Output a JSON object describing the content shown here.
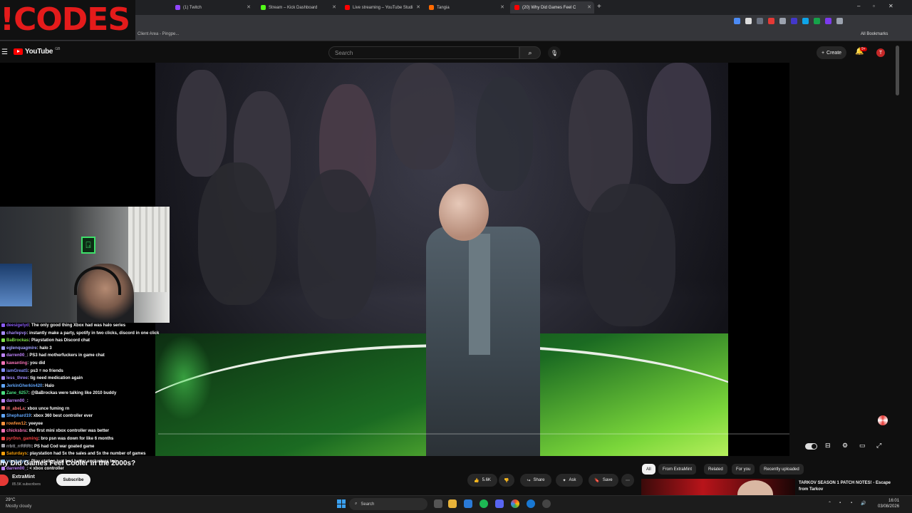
{
  "browser": {
    "tabs": [
      {
        "label": "(1) Twitch",
        "color": "#9146ff"
      },
      {
        "label": "Stream – Kick Dashboard",
        "color": "#53fc18"
      },
      {
        "label": "Live streaming – YouTube Studi",
        "color": "#ff0000"
      },
      {
        "label": "Tangia",
        "color": "#ff6a00"
      },
      {
        "label": "(20) Why Did Games Feel C",
        "color": "#ff0000"
      }
    ],
    "bookmarks": {
      "client": "Client Area - Pingpe...",
      "all": "All Bookmarks"
    }
  },
  "overlay": {
    "logo_text": "!CODES"
  },
  "youtube": {
    "logo": "YouTube",
    "country": "GB",
    "search_placeholder": "Search",
    "create_label": "Create",
    "notifications": "9+",
    "avatar_letter": "T"
  },
  "video": {
    "title": "hy Did Games Feel Cooler in the 2000s?",
    "channel": "ExtraMint",
    "subscribers": "85.5K subscribers",
    "subscribe_label": "Subscribe",
    "likes": "5.6K",
    "share_label": "Share",
    "ask_label": "Ask",
    "save_label": "Save"
  },
  "chips": [
    "All",
    "From ExtraMint",
    "Related",
    "For you",
    "Recently uploaded"
  ],
  "recommended": {
    "title": "TARKOV SEASON 1 PATCH NOTES! - Escape from Tarkov"
  },
  "chat": [
    {
      "user": "deesigetyd",
      "msg": "The only good thing Xbox had was halo series",
      "color": "#8b5cf6"
    },
    {
      "user": "charlepvp",
      "msg": "instantly make a party, spotify in two clicks, discord in one click",
      "color": "#a78bfa"
    },
    {
      "user": "BaBrockas",
      "msg": "Playstation has Discord chat",
      "color": "#7ee04a"
    },
    {
      "user": "eglenquagmire",
      "msg": "halo 3",
      "color": "#a3a3ff"
    },
    {
      "user": "darren00_",
      "msg": "PS3 had motherfuckers in game chat",
      "color": "#c084fc"
    },
    {
      "user": "kawanting",
      "msg": "you did",
      "color": "#f472b6"
    },
    {
      "user": "iamGreatS",
      "msg": "ps3 = no friends",
      "color": "#818cf8"
    },
    {
      "user": "less_three",
      "msg": "tig need medication again",
      "color": "#a78bfa"
    },
    {
      "user": "JerkinGherkin420",
      "msg": "Halo",
      "color": "#60a5fa"
    },
    {
      "user": "Zane_6257",
      "msg": "@BaBrockas were talking like 2010 buddy",
      "color": "#4ade80"
    },
    {
      "user": "darren00_",
      "msg": "",
      "color": "#c084fc"
    },
    {
      "user": "ill_abeLa",
      "msg": "xbox unce fuming rn",
      "color": "#f87171"
    },
    {
      "user": "Shephard19",
      "msg": "xbox 360 best controller ever",
      "color": "#60a5fa"
    },
    {
      "user": "rowfew12",
      "msg": "yeeyee",
      "color": "#fb923c"
    },
    {
      "user": "chicksbra",
      "msg": "the first mini xbox controller was better",
      "color": "#f472b6"
    },
    {
      "user": "pyr0nn_gaming",
      "msg": "bro psn was down for like 6 months",
      "color": "#ef4444"
    },
    {
      "user": "rrbtt_rrRRRt",
      "msg": "PS had Cod war goated game",
      "color": "#a1a1aa"
    },
    {
      "user": "Saturdays",
      "msg": "playstation had 5x the sales and 5x the number of games",
      "color": "#f59e0b"
    },
    {
      "user": "yoyoyoyoy",
      "msg": "Play station just had better exclusives too",
      "color": "#93c5fd"
    },
    {
      "user": "darren00_",
      "msg": "< xbox controller",
      "color": "#c084fc"
    }
  ],
  "taskbar": {
    "temp": "29°C",
    "weather": "Mostly cloudy",
    "search": "Search",
    "time": "16:01",
    "date": "03/08/2026"
  }
}
